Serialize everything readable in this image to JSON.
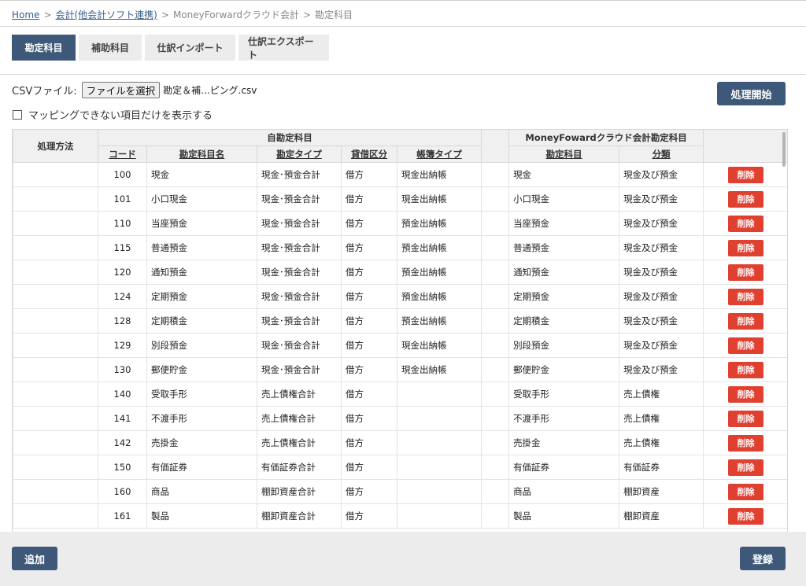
{
  "breadcrumb": {
    "home": "Home",
    "accounting": "会計(他会計ソフト連携)",
    "sep": ">",
    "mf": "MoneyForwardクラウド会計",
    "current": "勘定科目"
  },
  "tabs": [
    "勘定科目",
    "補助科目",
    "仕訳インポート",
    "仕訳エクスポート"
  ],
  "csv": {
    "label": "CSVファイル:",
    "file_button": "ファイルを選択",
    "file_name": "勘定＆補...ピング.csv"
  },
  "start_button": "処理開始",
  "unmapped_only_label": "マッピングできない項目だけを表示する",
  "table": {
    "col_process": "処理方法",
    "group_own": "自勘定科目",
    "group_mf": "MoneyFowardクラウド会計勘定科目",
    "h_code": "コード",
    "h_name": "勘定科目名",
    "h_type": "勘定タイプ",
    "h_dc": "貸借区分",
    "h_book": "帳簿タイプ",
    "h_mf_account": "勘定科目",
    "h_mf_class": "分類",
    "delete_label": "削除",
    "rows": [
      {
        "code": "100",
        "name": "現金",
        "type": "現金･預金合計",
        "dc": "借方",
        "book": "現金出納帳",
        "mf_account": "現金",
        "mf_class": "現金及び預金"
      },
      {
        "code": "101",
        "name": "小口現金",
        "type": "現金･預金合計",
        "dc": "借方",
        "book": "現金出納帳",
        "mf_account": "小口現金",
        "mf_class": "現金及び預金"
      },
      {
        "code": "110",
        "name": "当座預金",
        "type": "現金･預金合計",
        "dc": "借方",
        "book": "預金出納帳",
        "mf_account": "当座預金",
        "mf_class": "現金及び預金"
      },
      {
        "code": "115",
        "name": "普通預金",
        "type": "現金･預金合計",
        "dc": "借方",
        "book": "預金出納帳",
        "mf_account": "普通預金",
        "mf_class": "現金及び預金"
      },
      {
        "code": "120",
        "name": "通知預金",
        "type": "現金･預金合計",
        "dc": "借方",
        "book": "預金出納帳",
        "mf_account": "通知預金",
        "mf_class": "現金及び預金"
      },
      {
        "code": "124",
        "name": "定期預金",
        "type": "現金･預金合計",
        "dc": "借方",
        "book": "預金出納帳",
        "mf_account": "定期預金",
        "mf_class": "現金及び預金"
      },
      {
        "code": "128",
        "name": "定期積金",
        "type": "現金･預金合計",
        "dc": "借方",
        "book": "預金出納帳",
        "mf_account": "定期積金",
        "mf_class": "現金及び預金"
      },
      {
        "code": "129",
        "name": "別段預金",
        "type": "現金･預金合計",
        "dc": "借方",
        "book": "現金出納帳",
        "mf_account": "別段預金",
        "mf_class": "現金及び預金"
      },
      {
        "code": "130",
        "name": "郵便貯金",
        "type": "現金･預金合計",
        "dc": "借方",
        "book": "現金出納帳",
        "mf_account": "郵便貯金",
        "mf_class": "現金及び預金"
      },
      {
        "code": "140",
        "name": "受取手形",
        "type": "売上債権合計",
        "dc": "借方",
        "book": "",
        "mf_account": "受取手形",
        "mf_class": "売上債権"
      },
      {
        "code": "141",
        "name": "不渡手形",
        "type": "売上債権合計",
        "dc": "借方",
        "book": "",
        "mf_account": "不渡手形",
        "mf_class": "売上債権"
      },
      {
        "code": "142",
        "name": "売掛金",
        "type": "売上債権合計",
        "dc": "借方",
        "book": "",
        "mf_account": "売掛金",
        "mf_class": "売上債権"
      },
      {
        "code": "150",
        "name": "有価証券",
        "type": "有価証券合計",
        "dc": "借方",
        "book": "",
        "mf_account": "有価証券",
        "mf_class": "有価証券"
      },
      {
        "code": "160",
        "name": "商品",
        "type": "棚卸資産合計",
        "dc": "借方",
        "book": "",
        "mf_account": "商品",
        "mf_class": "棚卸資産"
      },
      {
        "code": "161",
        "name": "製品",
        "type": "棚卸資産合計",
        "dc": "借方",
        "book": "",
        "mf_account": "製品",
        "mf_class": "棚卸資産"
      }
    ]
  },
  "add_button": "追加",
  "register_button": "登録"
}
